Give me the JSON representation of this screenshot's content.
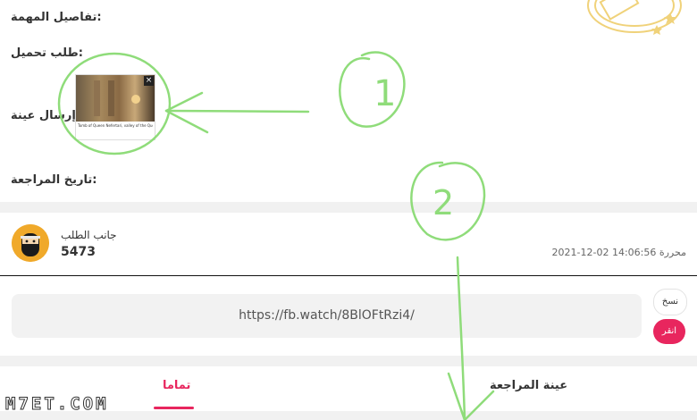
{
  "fields": {
    "task_details": ":تفاصيل المهمة",
    "upload_request": ":طلب تحميل",
    "send_sample": ":إرسال عينة",
    "review_date": ":تاريخ المراجعة"
  },
  "sample_thumbnail": {
    "caption": "Tomb of Queen Nefertari, valley of the Queens",
    "close_glyph": "×"
  },
  "requester": {
    "label": "جانب الطلب",
    "id": "5473",
    "avatar_icon": "ninja-avatar-icon"
  },
  "timestamp": {
    "prefix": "محررة",
    "value": "2021-12-02 14:06:56"
  },
  "link": {
    "url": "https://fb.watch/8BlOFtRzi4/"
  },
  "buttons": {
    "copy": "نسخ",
    "click": "انقر"
  },
  "tabs": [
    {
      "label": "تماما",
      "active": true
    },
    {
      "label": "عينة المراجعة",
      "active": false
    }
  ],
  "annotations": {
    "marker_1": "1",
    "marker_2": "2"
  },
  "watermark": {
    "text": "M7ET.COM"
  },
  "colors": {
    "accent": "#e8265e",
    "annotation_green": "#8fdc7a",
    "stamp_yellow": "#f0d27a",
    "avatar_orange": "#f0a92a"
  }
}
